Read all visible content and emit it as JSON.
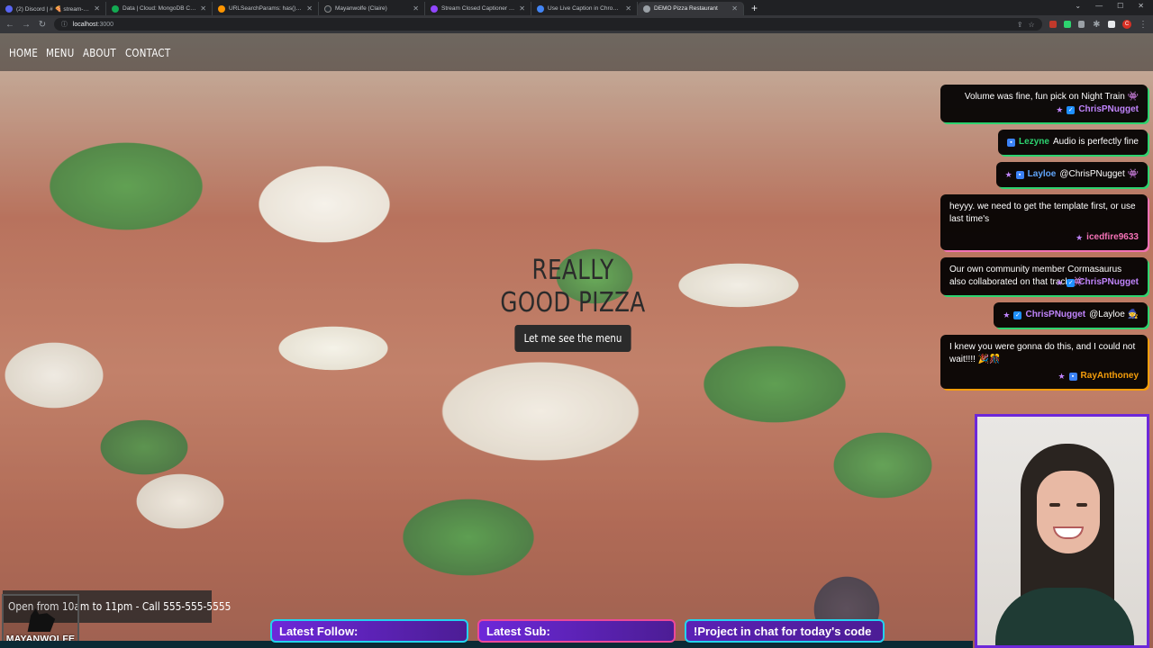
{
  "browser": {
    "tabs": [
      {
        "title": "(2) Discord | # 🍕 stream-team |",
        "color": "#5865f2",
        "active": false
      },
      {
        "title": "Data | Cloud: MongoDB Cloud",
        "color": "#13aa52",
        "active": false
      },
      {
        "title": "URLSearchParams: has() method",
        "color": "#ff9500",
        "active": false
      },
      {
        "title": "Mayanwolfe (Claire)",
        "color": "#24292f",
        "active": false
      },
      {
        "title": "Stream Closed Captioner - C",
        "color": "#9146ff",
        "active": false
      },
      {
        "title": "Use Live Caption in Chrome - G",
        "color": "#4285f4",
        "active": false
      },
      {
        "title": "DEMO Pizza Restaurant",
        "color": "#9aa0a6",
        "active": true
      }
    ],
    "url_host": "localhost",
    "url_port": ":3000",
    "profile_initial": "C"
  },
  "site": {
    "nav": [
      "HOME",
      "MENU",
      "ABOUT",
      "CONTACT"
    ],
    "hero_line1": "REALLY",
    "hero_line2": "GOOD PIZZA",
    "hero_button": "Let me see the menu"
  },
  "chat": [
    {
      "text": "Volume was fine, fun pick on Night Train 👾",
      "user": "ChrisPNugget",
      "user_class": "u-chris",
      "inline": false
    },
    {
      "text": "Audio is perfectly fine",
      "user": "Lezyne",
      "user_class": "u-lez",
      "inline": true
    },
    {
      "text": "@ChrisPNugget 👾",
      "user": "Layloe",
      "user_class": "u-lay",
      "inline": true
    },
    {
      "text": "heyyy. we need to get the template first, or use last time's",
      "user": "icedfire9633",
      "user_class": "u-ice",
      "inline": false
    },
    {
      "text": "Our own community member Cormasaurus also collaborated on that track 👾",
      "user": "ChrisPNugget",
      "user_class": "u-chris",
      "inline": false
    },
    {
      "text": "@Layloe 🧙",
      "user": "ChrisPNugget",
      "user_class": "u-chris",
      "inline": true
    },
    {
      "text": "I knew you were gonna do this, and I could not wait!!!! 🎉🎊",
      "user": "RayAnthoney",
      "user_class": "u-ray",
      "inline": false
    }
  ],
  "overlay": {
    "hours": "Open from 10am to 11pm - Call 555-555-5555",
    "logo": "MAYANWOLFE",
    "latest_follow": "Latest Follow:",
    "latest_sub": "Latest Sub:",
    "project": "!Project in chat for today's code"
  },
  "colors": {
    "accent_purple": "#6d28d9",
    "chat_green": "#2dd36f",
    "cyan_border": "#22d3ee",
    "pink_border": "#ec4899"
  }
}
